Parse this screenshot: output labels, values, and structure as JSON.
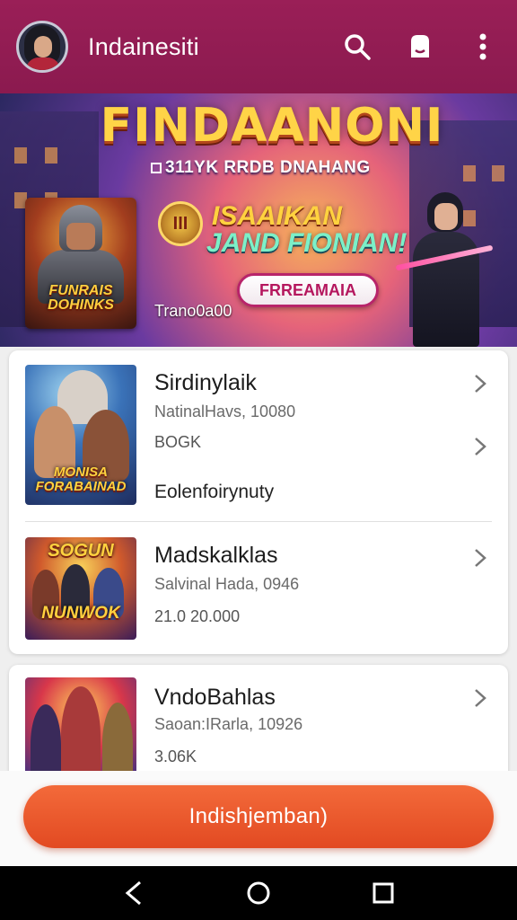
{
  "header": {
    "title": "Indainesiti",
    "icons": [
      "search-icon",
      "notification-icon",
      "more-vert-icon"
    ]
  },
  "banner": {
    "title": "FINDAANONI",
    "subtitle": "311YK RRDB DNAHANG",
    "poster_text": "FUNRAIS DOHINKS",
    "medal_text": "III",
    "promo_line1": "ISAAIKAN",
    "promo_line2": "JAND FIONIAN!",
    "button_label": "FRREAMAIA",
    "caption": "Trano0a00"
  },
  "items": [
    {
      "title": "Sirdinylaik",
      "subtitle": "NatinalHavs, 10080",
      "meta": "BOGK",
      "tag": "Eolenfoirynuty",
      "thumb_text": "MONISA FORABAINAD"
    },
    {
      "title": "Madskalklas",
      "subtitle": "Salvinal Hada, 0946",
      "meta": "21.0 20.000",
      "thumb_text_top": "SOGUN",
      "thumb_text_bottom": "NUNWOK"
    },
    {
      "title": "VndoBahlas",
      "subtitle": "Saoan:IRarla, 10926",
      "meta": "3.06K"
    }
  ],
  "cta": {
    "label": "Indishjemban)"
  },
  "colors": {
    "header_bg": "#8b1a4f",
    "cta_bg": "#e8522a",
    "promo_button_border": "#b8246a"
  }
}
